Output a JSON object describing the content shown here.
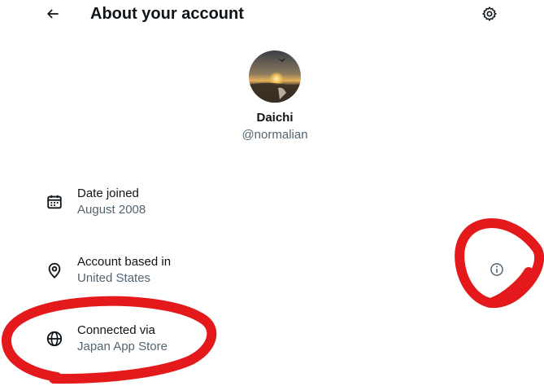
{
  "header": {
    "title": "About your account",
    "back_icon": "arrow-left-icon",
    "settings_icon": "gear-icon"
  },
  "profile": {
    "name": "Daichi",
    "handle": "@normalian",
    "avatar_icon": "avatar-sunset-photo"
  },
  "rows": [
    {
      "icon": "calendar-icon",
      "label": "Date joined",
      "value": "August 2008"
    },
    {
      "icon": "location-pin-icon",
      "label": "Account based in",
      "value": "United States"
    },
    {
      "icon": "globe-icon",
      "label": "Connected via",
      "value": "Japan App Store"
    }
  ],
  "info_icon": "info-circle-icon",
  "colors": {
    "text_primary": "#0f1419",
    "text_secondary": "#536471",
    "annotation_red": "#e3191c"
  }
}
